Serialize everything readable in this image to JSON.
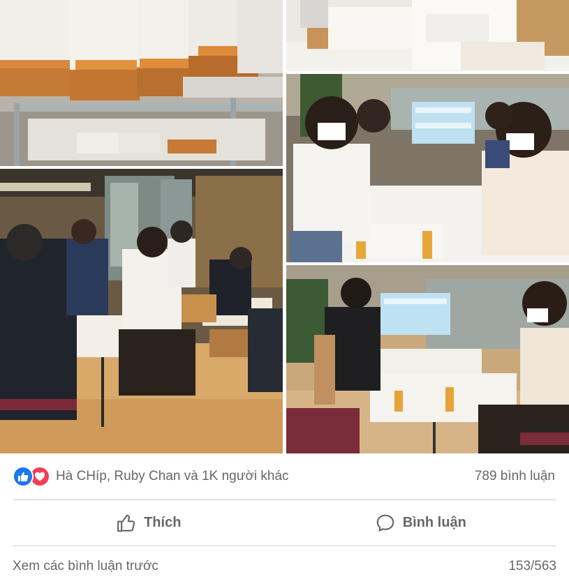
{
  "post": {
    "photos": [
      {
        "name": "photo-envelopes",
        "subject": "stacks of envelopes on a metal cart"
      },
      {
        "name": "photo-office-table",
        "subject": "staff at a table in a warm-lit office"
      },
      {
        "name": "photo-hands-gloves",
        "subject": "gloved hands sorting items"
      },
      {
        "name": "photo-women-masks",
        "subject": "women in masks packing at a table"
      },
      {
        "name": "photo-packing-table",
        "subject": "two people packing masks in an open office"
      }
    ],
    "reactions": {
      "icons": [
        "like-icon",
        "love-icon"
      ],
      "colors": {
        "like": "#1877f2",
        "love": "#f33e58"
      },
      "summary": "Hà CHíp, Ruby Chan và 1K người khác",
      "comment_count": "789 bình luận"
    },
    "actions": {
      "like_label": "Thích",
      "comment_label": "Bình luận"
    },
    "comments": {
      "view_previous": "Xem các bình luận trước",
      "page_count": "153/563"
    }
  }
}
